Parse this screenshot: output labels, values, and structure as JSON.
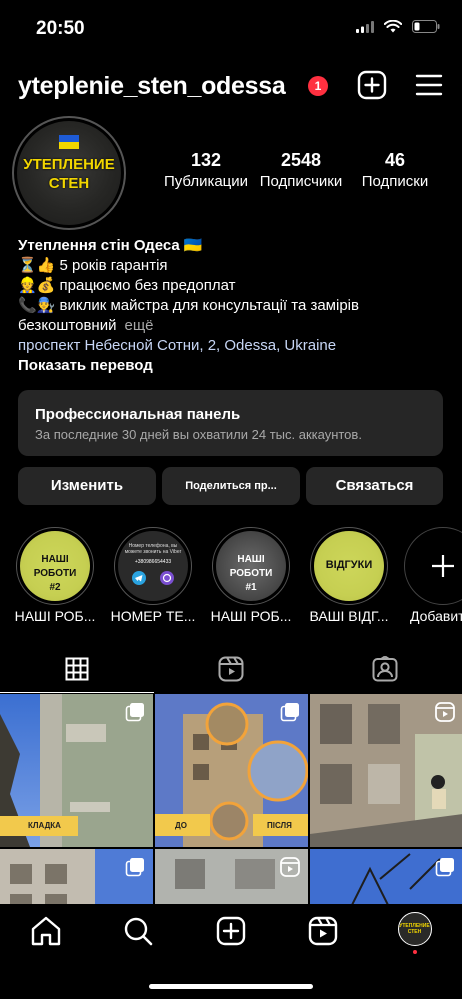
{
  "status": {
    "time": "20:50"
  },
  "header": {
    "username": "yteplenie_sten_odessa",
    "notifications": "1"
  },
  "profile": {
    "avatar_text": [
      "УТЕПЛЕНИЕ",
      "СТЕН"
    ],
    "stats": [
      {
        "value": "132",
        "label": "Публикации"
      },
      {
        "value": "2548",
        "label": "Подписчики"
      },
      {
        "value": "46",
        "label": "Подписки"
      }
    ],
    "bio": {
      "name": "Утеплення стін Одеса 🇺🇦",
      "lines": [
        "⏳👍 5 років гарантія",
        "👷💰 працюємо без предоплат",
        "📞👨‍🔧 виклик майстра для консультації та замірів",
        "безкоштовний"
      ],
      "more": "ещё",
      "location": "проспект Небесной Сотни, 2, Odessa, Ukraine",
      "translate": "Показать перевод"
    }
  },
  "pro_panel": {
    "title": "Профессиональная панель",
    "subtitle": "За последние 30 дней вы охватили 24 тыс. аккаунтов."
  },
  "buttons": {
    "edit": "Изменить",
    "share": "Поделиться пр...",
    "contact": "Связаться"
  },
  "highlights": [
    {
      "label": "НАШІ РОБ...",
      "cover": [
        "НАШІ РОБОТИ",
        "#2"
      ]
    },
    {
      "label": "НОМЕР ТЕ...",
      "cover": [
        "Номер телефона, вы можете звонить на Viber"
      ]
    },
    {
      "label": "НАШІ РОБ...",
      "cover": [
        "НАШІ РОБОТИ",
        "#1"
      ]
    },
    {
      "label": "ВАШІ ВІДГ...",
      "cover": [
        "ВІДГУКИ"
      ]
    },
    {
      "label": "Добавить",
      "cover": []
    }
  ],
  "highlight_phone": "+380986654433",
  "grid": {
    "tiles": [
      {
        "caption": "КЛАДКА"
      },
      {
        "caption_left": "ДО",
        "caption_right": "ПІСЛЯ"
      }
    ]
  },
  "colors": {
    "accent_yellow": "#f2d600",
    "badge_red": "#ff3040",
    "panel_bg": "#262626",
    "link": "#c7d6f5"
  }
}
